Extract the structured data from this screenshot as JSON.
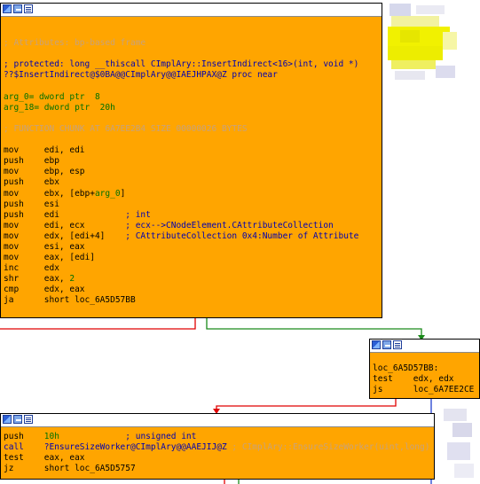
{
  "blocks": {
    "top": {
      "lines": [
        {
          "parts": [
            {
              "t": "",
              "c": ""
            }
          ]
        },
        {
          "parts": [
            {
              "t": "",
              "c": ""
            }
          ]
        },
        {
          "parts": [
            {
              "t": "; Attributes: bp-based frame",
              "c": "c-comment"
            }
          ]
        },
        {
          "parts": [
            {
              "t": "",
              "c": ""
            }
          ]
        },
        {
          "parts": [
            {
              "t": "; protected: long __thiscall CImplAry::InsertIndirect<16>(int, void *)",
              "c": "c-sym"
            }
          ]
        },
        {
          "parts": [
            {
              "t": "??$InsertIndirect@$0BA@@CImplAry@@IAEJHPAX@Z proc near",
              "c": "c-sym"
            }
          ]
        },
        {
          "parts": [
            {
              "t": "",
              "c": ""
            }
          ]
        },
        {
          "parts": [
            {
              "t": "arg_0= dword ptr  8",
              "c": "c-arg"
            }
          ]
        },
        {
          "parts": [
            {
              "t": "arg_18= dword ptr  20h",
              "c": "c-arg"
            }
          ]
        },
        {
          "parts": [
            {
              "t": "",
              "c": ""
            }
          ]
        },
        {
          "parts": [
            {
              "t": "; FUNCTION CHUNK AT 6A7EE2B4 SIZE 00000026 BYTES",
              "c": "c-comment"
            }
          ]
        },
        {
          "parts": [
            {
              "t": "",
              "c": ""
            }
          ]
        },
        {
          "parts": [
            {
              "t": "mov     edi, edi",
              "c": ""
            }
          ]
        },
        {
          "parts": [
            {
              "t": "push    ebp",
              "c": ""
            }
          ]
        },
        {
          "parts": [
            {
              "t": "mov     ebp, esp",
              "c": ""
            }
          ]
        },
        {
          "parts": [
            {
              "t": "push    ebx",
              "c": ""
            }
          ]
        },
        {
          "parts": [
            {
              "t": "mov     ebx, [ebp+",
              "c": ""
            },
            {
              "t": "arg_0",
              "c": "c-arg"
            },
            {
              "t": "]",
              "c": ""
            }
          ]
        },
        {
          "parts": [
            {
              "t": "push    esi",
              "c": ""
            }
          ]
        },
        {
          "parts": [
            {
              "t": "push    edi",
              "c": ""
            },
            {
              "t": "             ; int",
              "c": "c-sym"
            }
          ]
        },
        {
          "parts": [
            {
              "t": "mov     edi, ecx",
              "c": ""
            },
            {
              "t": "        ; ecx-->CNodeElement.CAttributeCollection",
              "c": "c-sym"
            }
          ]
        },
        {
          "parts": [
            {
              "t": "mov     edx, [edi+4]",
              "c": ""
            },
            {
              "t": "    ; CAttributeCollection 0x4:Number of Attribute",
              "c": "c-sym"
            }
          ]
        },
        {
          "parts": [
            {
              "t": "mov     esi, eax",
              "c": ""
            }
          ]
        },
        {
          "parts": [
            {
              "t": "mov     eax, [edi]",
              "c": ""
            }
          ]
        },
        {
          "parts": [
            {
              "t": "inc     edx",
              "c": ""
            }
          ]
        },
        {
          "parts": [
            {
              "t": "shr     eax, ",
              "c": ""
            },
            {
              "t": "2",
              "c": "c-arg"
            }
          ]
        },
        {
          "parts": [
            {
              "t": "cmp     edx, eax",
              "c": ""
            }
          ]
        },
        {
          "parts": [
            {
              "t": "ja      short loc_6A5D57BB",
              "c": ""
            }
          ]
        }
      ]
    },
    "right": {
      "lines": [
        {
          "parts": [
            {
              "t": "",
              "c": ""
            }
          ]
        },
        {
          "parts": [
            {
              "t": "loc_6A5D57BB:",
              "c": ""
            }
          ]
        },
        {
          "parts": [
            {
              "t": "test    edx, edx",
              "c": ""
            }
          ]
        },
        {
          "parts": [
            {
              "t": "js      loc_6A7EE2CE",
              "c": ""
            }
          ]
        }
      ]
    },
    "bottom": {
      "lines": [
        {
          "parts": [
            {
              "t": "push    ",
              "c": ""
            },
            {
              "t": "10h",
              "c": "c-arg"
            },
            {
              "t": "             ; unsigned int",
              "c": "c-sym"
            }
          ]
        },
        {
          "parts": [
            {
              "t": "call    ?EnsureSizeWorker@CImplAry@@AAEJIJ@Z",
              "c": "c-sym"
            },
            {
              "t": " ; CImplAry::EnsureSizeWorker(uint,long)",
              "c": "c-cmt2"
            }
          ]
        },
        {
          "parts": [
            {
              "t": "test    eax, eax",
              "c": ""
            }
          ]
        },
        {
          "parts": [
            {
              "t": "jz      short loc_6A5D5757",
              "c": ""
            }
          ]
        }
      ]
    }
  },
  "colors": {
    "node": "#ffa500",
    "edge_red": "#e00000",
    "edge_green": "#1a8a1a",
    "edge_blue": "#1f3fd0"
  }
}
